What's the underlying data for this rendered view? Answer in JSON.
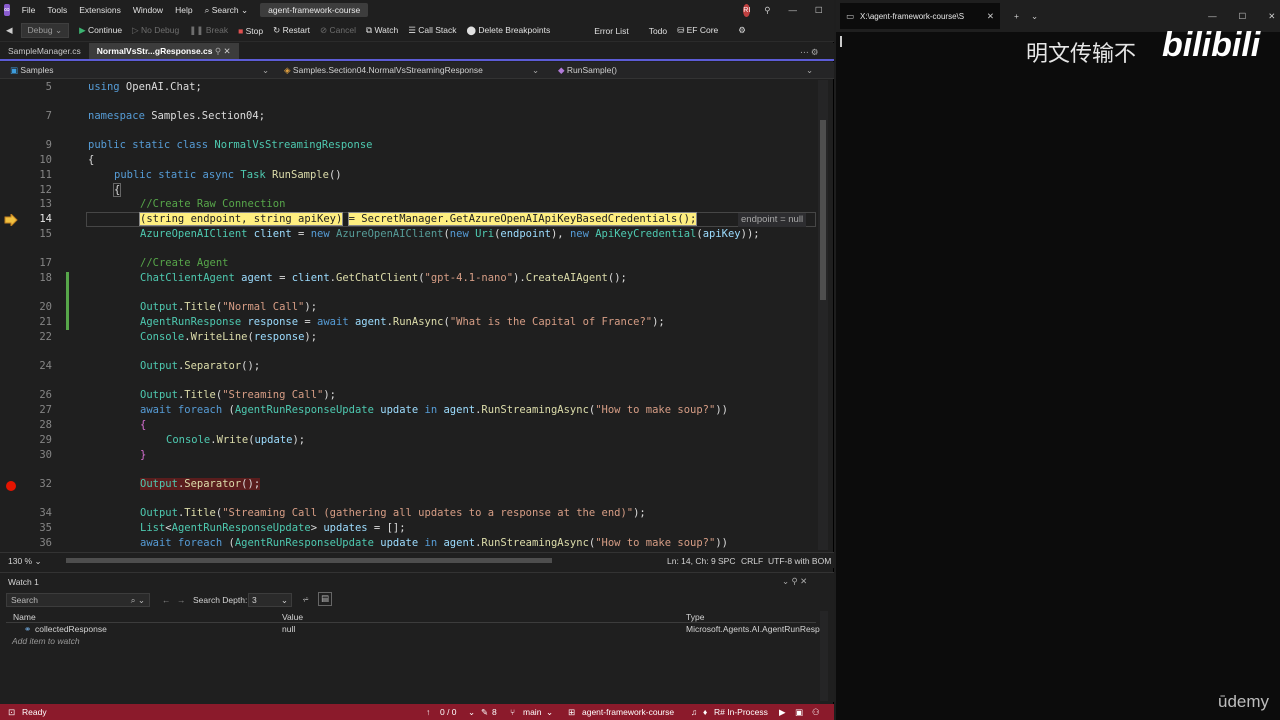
{
  "menu": {
    "items": [
      "File",
      "Tools",
      "Extensions",
      "Window",
      "Help"
    ],
    "search": "Search",
    "solution": "agent-framework-course",
    "user_initials": "RI"
  },
  "toolbar": {
    "config": "Debug",
    "continue": "Continue",
    "no_debug": "No Debug",
    "break": "Break",
    "stop": "Stop",
    "restart": "Restart",
    "cancel": "Cancel",
    "watch": "Watch",
    "call_stack": "Call Stack",
    "delete_breakpoints": "Delete Breakpoints",
    "error_list": "Error List",
    "todo": "Todo",
    "ef_core": "EF Core"
  },
  "tabs": [
    {
      "label": "SampleManager.cs"
    },
    {
      "label": "NormalVsStr...gResponse.cs"
    }
  ],
  "nav": {
    "project": "Samples",
    "class": "Samples.Section04.NormalVsStreamingResponse",
    "method": "RunSample()"
  },
  "code": {
    "line_numbers": [
      "5",
      "7",
      "9",
      "10",
      "11",
      "12",
      "13",
      "14",
      "15",
      "17",
      "18",
      "20",
      "21",
      "22",
      "24",
      "26",
      "27",
      "28",
      "29",
      "30",
      "32",
      "34",
      "35",
      "36"
    ],
    "inline_value": "endpoint = null"
  },
  "editor_status": {
    "zoom": "130 %",
    "position": "Ln: 14, Ch: 9",
    "spaces": "SPC",
    "eol": "CRLF",
    "encoding": "UTF-8 with BOM"
  },
  "watch": {
    "title": "Watch 1",
    "search_placeholder": "Search",
    "depth_label": "Search Depth:",
    "depth_value": "3",
    "col_name": "Name",
    "col_value": "Value",
    "col_type": "Type",
    "row_name": "collectedResponse",
    "row_value": "null",
    "row_type": "Microsoft.Agents.AI.AgentRunResp...",
    "add_item": "Add item to watch"
  },
  "statusbar": {
    "ready": "Ready",
    "errors": "0 / 0",
    "pencil": "8",
    "branch": "main",
    "repo": "agent-framework-course",
    "rs": "R# In-Process"
  },
  "terminal": {
    "tab_title": "X:\\agent-framework-course\\S"
  },
  "overlay": {
    "text": "明文传输不",
    "logo": "bilibili",
    "watermark": "ūdemy"
  }
}
